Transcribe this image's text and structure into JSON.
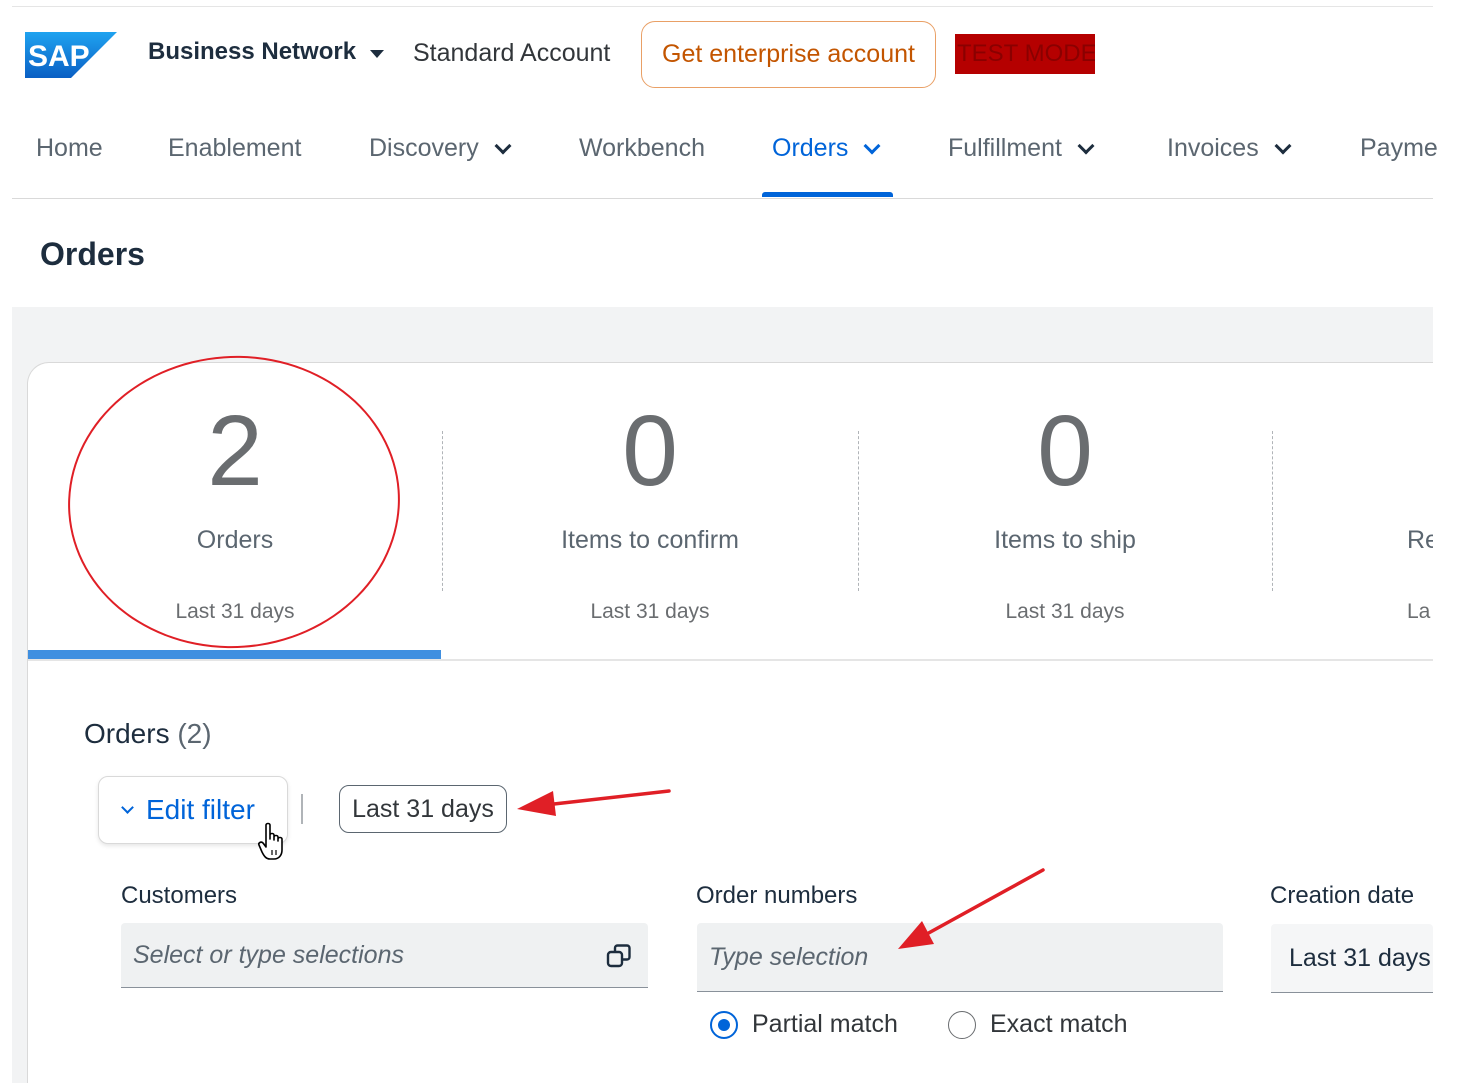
{
  "header": {
    "logo_text": "SAP",
    "product": "Business Network",
    "account_type": "Standard Account",
    "enterprise_button": "Get enterprise account",
    "test_mode": "TEST MODE"
  },
  "nav": {
    "items": [
      {
        "label": "Home"
      },
      {
        "label": "Enablement"
      },
      {
        "label": "Discovery"
      },
      {
        "label": "Workbench"
      },
      {
        "label": "Orders"
      },
      {
        "label": "Fulfillment"
      },
      {
        "label": "Invoices"
      },
      {
        "label": "Payme"
      }
    ],
    "active": "Orders"
  },
  "page": {
    "title": "Orders"
  },
  "tiles": [
    {
      "value": "2",
      "label": "Orders",
      "period": "Last 31 days"
    },
    {
      "value": "0",
      "label": "Items to confirm",
      "period": "Last 31 days"
    },
    {
      "value": "0",
      "label": "Items to ship",
      "period": "Last 31 days"
    },
    {
      "value": "",
      "label": "Re",
      "period": "La"
    }
  ],
  "list": {
    "title": "Orders",
    "count": "(2)",
    "edit_filter": "Edit filter",
    "filter_chip": "Last 31 days"
  },
  "filters": {
    "customers": {
      "label": "Customers",
      "placeholder": "Select or type selections"
    },
    "order_numbers": {
      "label": "Order numbers",
      "placeholder": "Type selection"
    },
    "creation_date": {
      "label": "Creation date",
      "value": "Last 31 days"
    },
    "match": {
      "partial": "Partial match",
      "exact": "Exact match",
      "selected": "partial"
    }
  },
  "colors": {
    "accent": "#0064d9",
    "enterprise_orange": "#c35500",
    "test_mode_bg": "#b50000",
    "annotation_red": "#e01f26"
  }
}
